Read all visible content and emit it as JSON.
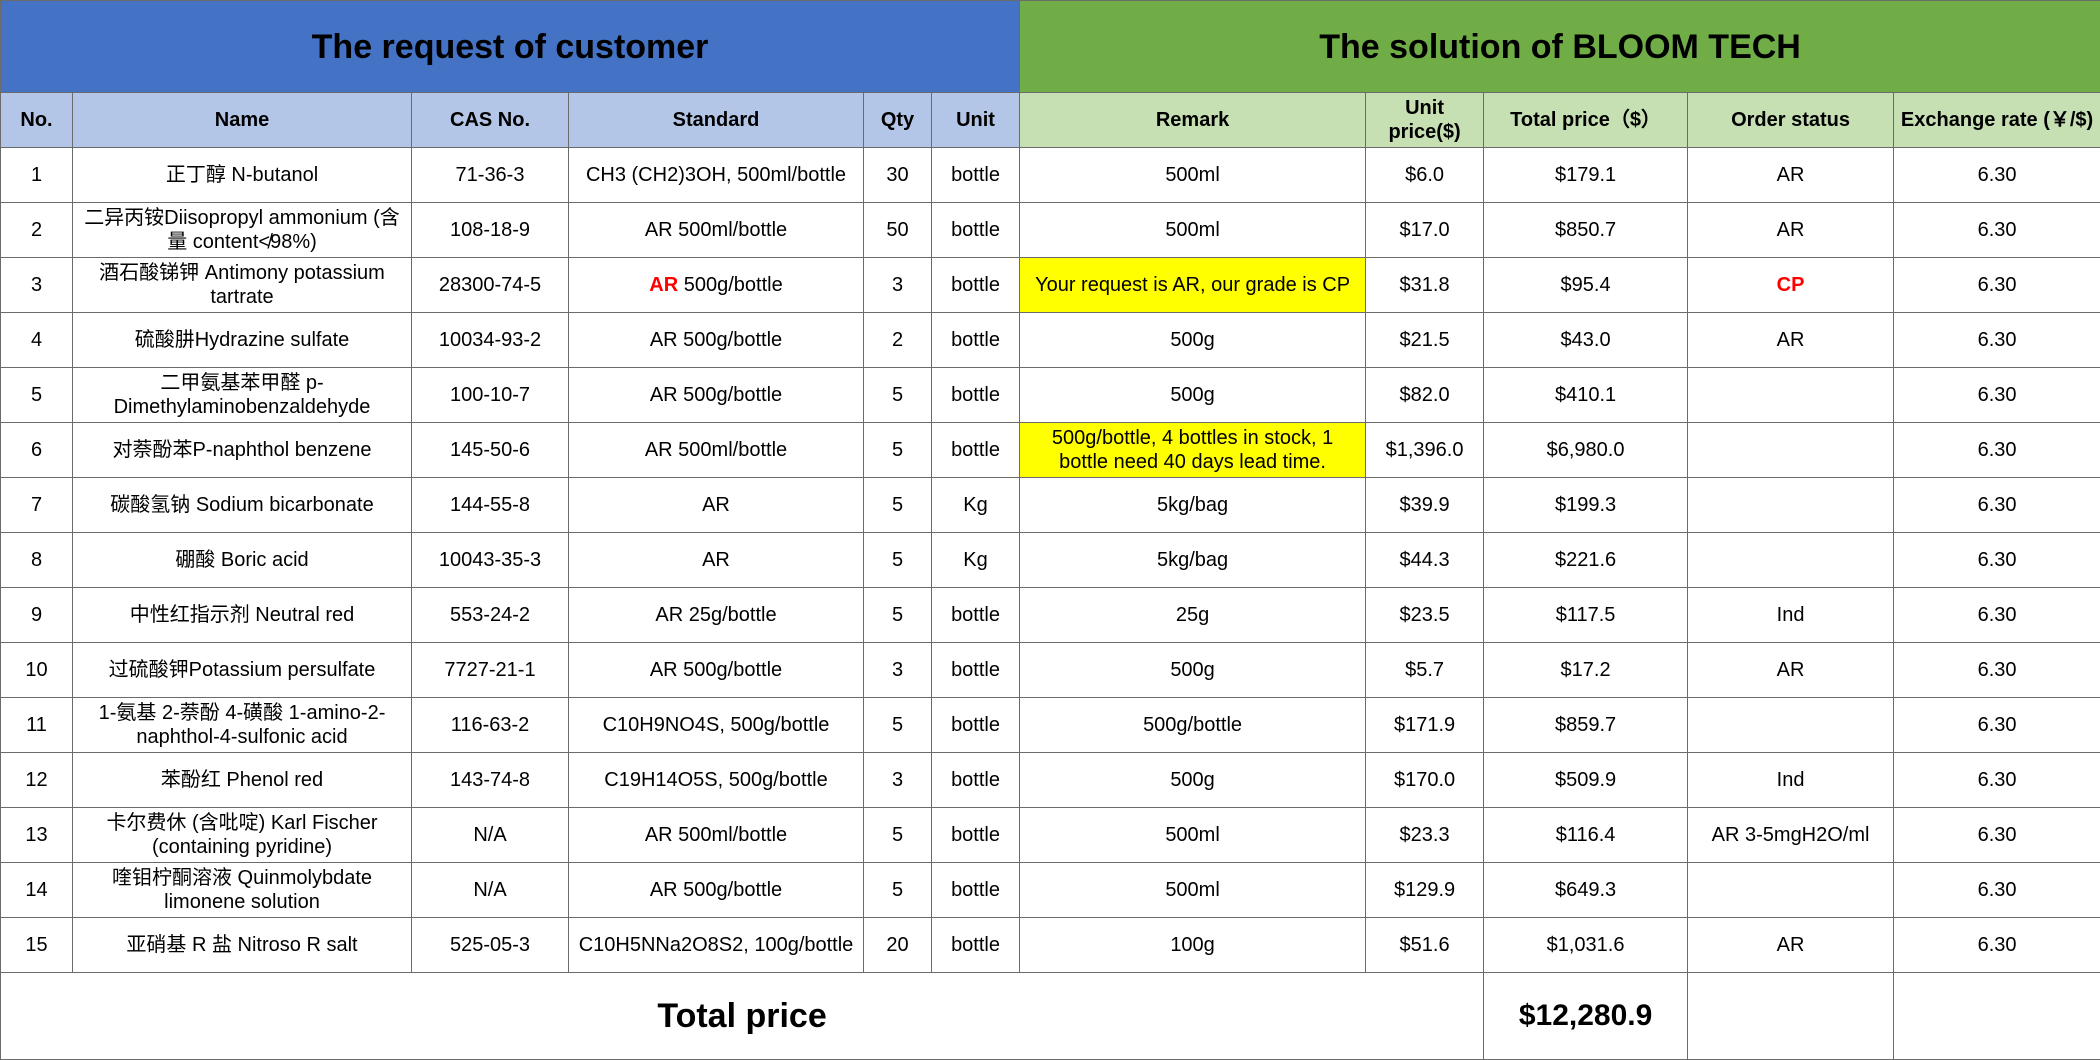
{
  "sections": {
    "request": "The request of customer",
    "solution": "The solution of BLOOM TECH"
  },
  "headers": {
    "no": "No.",
    "name": "Name",
    "cas": "CAS No.",
    "standard": "Standard",
    "qty": "Qty",
    "unit": "Unit",
    "remark": "Remark",
    "unit_price": "Unit price($)",
    "total_price": "Total price（$）",
    "order_status": "Order status",
    "exchange_rate": "Exchange rate (￥/$)"
  },
  "rows": [
    {
      "no": "1",
      "name": "正丁醇 N-butanol",
      "cas": "71-36-3",
      "standard": "CH3 (CH2)3OH, 500ml/bottle",
      "qty": "30",
      "unit": "bottle",
      "remark": "500ml",
      "unit_price": "$6.0",
      "total": "$179.1",
      "status": "AR",
      "rate": "6.30"
    },
    {
      "no": "2",
      "name": "二异丙铵Diisopropyl ammonium (含量 content≮98%)",
      "cas": "108-18-9",
      "standard": "AR 500ml/bottle",
      "qty": "50",
      "unit": "bottle",
      "remark": "500ml",
      "unit_price": "$17.0",
      "total": "$850.7",
      "status": "AR",
      "rate": "6.30"
    },
    {
      "no": "3",
      "name": "酒石酸锑钾 Antimony potassium tartrate",
      "cas": "28300-74-5",
      "standard_prefix": "AR",
      "standard": " 500g/bottle",
      "qty": "3",
      "unit": "bottle",
      "remark": "Your request is AR, our grade is CP",
      "unit_price": "$31.8",
      "total": "$95.4",
      "status": "CP",
      "rate": "6.30"
    },
    {
      "no": "4",
      "name": "硫酸肼Hydrazine sulfate",
      "cas": "10034-93-2",
      "standard": "AR 500g/bottle",
      "qty": "2",
      "unit": "bottle",
      "remark": "500g",
      "unit_price": "$21.5",
      "total": "$43.0",
      "status": "AR",
      "rate": "6.30"
    },
    {
      "no": "5",
      "name": "二甲氨基苯甲醛 p-Dimethylaminobenzaldehyde",
      "cas": "100-10-7",
      "standard": "AR 500g/bottle",
      "qty": "5",
      "unit": "bottle",
      "remark": "500g",
      "unit_price": "$82.0",
      "total": "$410.1",
      "status": "",
      "rate": "6.30"
    },
    {
      "no": "6",
      "name": "对萘酚苯P-naphthol benzene",
      "cas": "145-50-6",
      "standard": "AR 500ml/bottle",
      "qty": "5",
      "unit": "bottle",
      "remark": "500g/bottle, 4 bottles in stock, 1 bottle need 40 days lead time.",
      "unit_price": "$1,396.0",
      "total": "$6,980.0",
      "status": "",
      "rate": "6.30"
    },
    {
      "no": "7",
      "name": "碳酸氢钠 Sodium bicarbonate",
      "cas": "144-55-8",
      "standard": "AR",
      "qty": "5",
      "unit": "Kg",
      "remark": "5kg/bag",
      "unit_price": "$39.9",
      "total": "$199.3",
      "status": "",
      "rate": "6.30"
    },
    {
      "no": "8",
      "name": "硼酸 Boric acid",
      "cas": "10043-35-3",
      "standard": "AR",
      "qty": "5",
      "unit": "Kg",
      "remark": "5kg/bag",
      "unit_price": "$44.3",
      "total": "$221.6",
      "status": "",
      "rate": "6.30"
    },
    {
      "no": "9",
      "name": "中性红指示剂 Neutral red",
      "cas": "553-24-2",
      "standard": "AR 25g/bottle",
      "qty": "5",
      "unit": "bottle",
      "remark": "25g",
      "unit_price": "$23.5",
      "total": "$117.5",
      "status": "Ind",
      "rate": "6.30"
    },
    {
      "no": "10",
      "name": "过硫酸钾Potassium persulfate",
      "cas": "7727-21-1",
      "standard": "AR 500g/bottle",
      "qty": "3",
      "unit": "bottle",
      "remark": "500g",
      "unit_price": "$5.7",
      "total": "$17.2",
      "status": "AR",
      "rate": "6.30"
    },
    {
      "no": "11",
      "name": "1-氨基 2-萘酚 4-磺酸 1-amino-2-naphthol-4-sulfonic acid",
      "cas": "116-63-2",
      "standard": "C10H9NO4S, 500g/bottle",
      "qty": "5",
      "unit": "bottle",
      "remark": "500g/bottle",
      "unit_price": "$171.9",
      "total": "$859.7",
      "status": "",
      "rate": "6.30"
    },
    {
      "no": "12",
      "name": "苯酚红 Phenol red",
      "cas": "143-74-8",
      "standard": "C19H14O5S, 500g/bottle",
      "qty": "3",
      "unit": "bottle",
      "remark": "500g",
      "unit_price": "$170.0",
      "total": "$509.9",
      "status": "Ind",
      "rate": "6.30"
    },
    {
      "no": "13",
      "name": "卡尔费休 (含吡啶) Karl Fischer (containing pyridine)",
      "cas": "N/A",
      "standard": "AR 500ml/bottle",
      "qty": "5",
      "unit": "bottle",
      "remark": "500ml",
      "unit_price": "$23.3",
      "total": "$116.4",
      "status": "AR 3-5mgH2O/ml",
      "rate": "6.30"
    },
    {
      "no": "14",
      "name": "喹钼柠酮溶液 Quinmolybdate limonene solution",
      "cas": "N/A",
      "standard": "AR 500g/bottle",
      "qty": "5",
      "unit": "bottle",
      "remark": "500ml",
      "unit_price": "$129.9",
      "total": "$649.3",
      "status": "",
      "rate": "6.30"
    },
    {
      "no": "15",
      "name": "亚硝基 R 盐 Nitroso R salt",
      "cas": "525-05-3",
      "standard": "C10H5NNa2O8S2, 100g/bottle",
      "qty": "20",
      "unit": "bottle",
      "remark": "100g",
      "unit_price": "$51.6",
      "total": "$1,031.6",
      "status": "AR",
      "rate": "6.30"
    }
  ],
  "footer": {
    "label": "Total price",
    "value": "$12,280.9"
  },
  "colors": {
    "request_header": "#4472c4",
    "solution_header": "#70ad47",
    "request_subheader": "#b4c6e7",
    "solution_subheader": "#c6e0b4",
    "highlight": "#ffff00",
    "alert_text": "#ff0000"
  }
}
